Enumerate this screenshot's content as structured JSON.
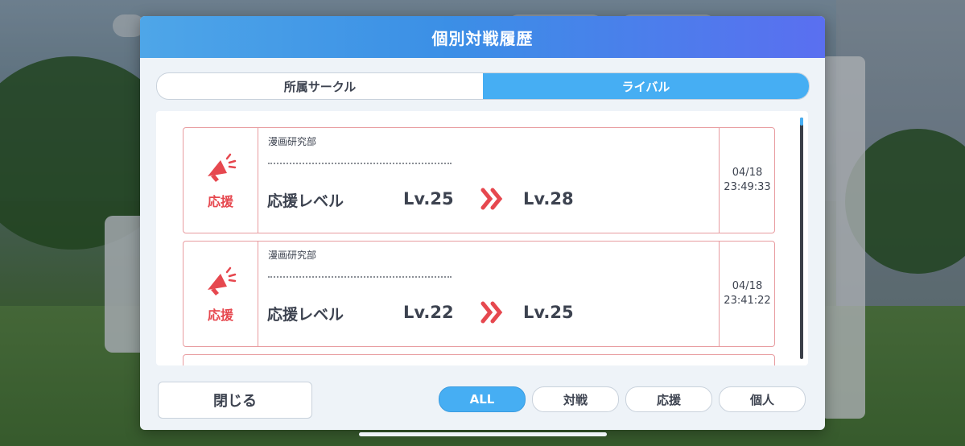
{
  "dialog": {
    "title": "個別対戦履歴",
    "tabs": [
      {
        "label": "所属サークル",
        "active": false
      },
      {
        "label": "ライバル",
        "active": true
      }
    ],
    "entries": [
      {
        "type_label": "応援",
        "circle": "漫画研究部",
        "stat_label": "応援レベル",
        "from": "Lv.25",
        "to": "Lv.28",
        "date": "04/18",
        "time": "23:49:33"
      },
      {
        "type_label": "応援",
        "circle": "漫画研究部",
        "stat_label": "応援レベル",
        "from": "Lv.22",
        "to": "Lv.25",
        "date": "04/18",
        "time": "23:41:22"
      }
    ],
    "close_label": "閉じる",
    "filters": [
      {
        "label": "ALL",
        "active": true
      },
      {
        "label": "対戦",
        "active": false
      },
      {
        "label": "応援",
        "active": false
      },
      {
        "label": "個人",
        "active": false
      }
    ],
    "scroll_position": 0.0
  },
  "colors": {
    "accent": "#46aef3",
    "card_border": "#e89ca0",
    "support_red": "#e6484f"
  },
  "icons": {
    "entry_icon": "megaphone-icon",
    "arrow_icon": "double-chevron-right-icon"
  }
}
